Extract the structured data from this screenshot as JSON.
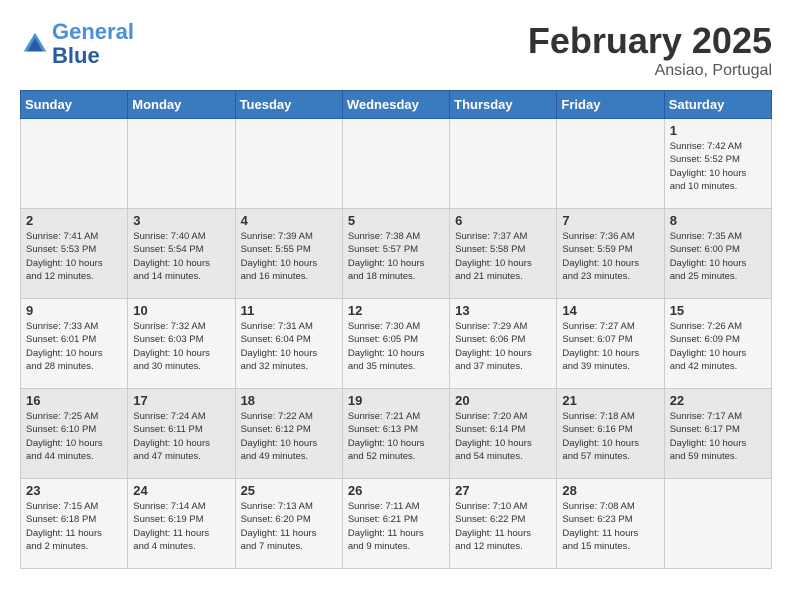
{
  "header": {
    "logo_line1": "General",
    "logo_line2": "Blue",
    "month": "February 2025",
    "location": "Ansiao, Portugal"
  },
  "weekdays": [
    "Sunday",
    "Monday",
    "Tuesday",
    "Wednesday",
    "Thursday",
    "Friday",
    "Saturday"
  ],
  "weeks": [
    [
      {
        "day": "",
        "info": ""
      },
      {
        "day": "",
        "info": ""
      },
      {
        "day": "",
        "info": ""
      },
      {
        "day": "",
        "info": ""
      },
      {
        "day": "",
        "info": ""
      },
      {
        "day": "",
        "info": ""
      },
      {
        "day": "1",
        "info": "Sunrise: 7:42 AM\nSunset: 5:52 PM\nDaylight: 10 hours\nand 10 minutes."
      }
    ],
    [
      {
        "day": "2",
        "info": "Sunrise: 7:41 AM\nSunset: 5:53 PM\nDaylight: 10 hours\nand 12 minutes."
      },
      {
        "day": "3",
        "info": "Sunrise: 7:40 AM\nSunset: 5:54 PM\nDaylight: 10 hours\nand 14 minutes."
      },
      {
        "day": "4",
        "info": "Sunrise: 7:39 AM\nSunset: 5:55 PM\nDaylight: 10 hours\nand 16 minutes."
      },
      {
        "day": "5",
        "info": "Sunrise: 7:38 AM\nSunset: 5:57 PM\nDaylight: 10 hours\nand 18 minutes."
      },
      {
        "day": "6",
        "info": "Sunrise: 7:37 AM\nSunset: 5:58 PM\nDaylight: 10 hours\nand 21 minutes."
      },
      {
        "day": "7",
        "info": "Sunrise: 7:36 AM\nSunset: 5:59 PM\nDaylight: 10 hours\nand 23 minutes."
      },
      {
        "day": "8",
        "info": "Sunrise: 7:35 AM\nSunset: 6:00 PM\nDaylight: 10 hours\nand 25 minutes."
      }
    ],
    [
      {
        "day": "9",
        "info": "Sunrise: 7:33 AM\nSunset: 6:01 PM\nDaylight: 10 hours\nand 28 minutes."
      },
      {
        "day": "10",
        "info": "Sunrise: 7:32 AM\nSunset: 6:03 PM\nDaylight: 10 hours\nand 30 minutes."
      },
      {
        "day": "11",
        "info": "Sunrise: 7:31 AM\nSunset: 6:04 PM\nDaylight: 10 hours\nand 32 minutes."
      },
      {
        "day": "12",
        "info": "Sunrise: 7:30 AM\nSunset: 6:05 PM\nDaylight: 10 hours\nand 35 minutes."
      },
      {
        "day": "13",
        "info": "Sunrise: 7:29 AM\nSunset: 6:06 PM\nDaylight: 10 hours\nand 37 minutes."
      },
      {
        "day": "14",
        "info": "Sunrise: 7:27 AM\nSunset: 6:07 PM\nDaylight: 10 hours\nand 39 minutes."
      },
      {
        "day": "15",
        "info": "Sunrise: 7:26 AM\nSunset: 6:09 PM\nDaylight: 10 hours\nand 42 minutes."
      }
    ],
    [
      {
        "day": "16",
        "info": "Sunrise: 7:25 AM\nSunset: 6:10 PM\nDaylight: 10 hours\nand 44 minutes."
      },
      {
        "day": "17",
        "info": "Sunrise: 7:24 AM\nSunset: 6:11 PM\nDaylight: 10 hours\nand 47 minutes."
      },
      {
        "day": "18",
        "info": "Sunrise: 7:22 AM\nSunset: 6:12 PM\nDaylight: 10 hours\nand 49 minutes."
      },
      {
        "day": "19",
        "info": "Sunrise: 7:21 AM\nSunset: 6:13 PM\nDaylight: 10 hours\nand 52 minutes."
      },
      {
        "day": "20",
        "info": "Sunrise: 7:20 AM\nSunset: 6:14 PM\nDaylight: 10 hours\nand 54 minutes."
      },
      {
        "day": "21",
        "info": "Sunrise: 7:18 AM\nSunset: 6:16 PM\nDaylight: 10 hours\nand 57 minutes."
      },
      {
        "day": "22",
        "info": "Sunrise: 7:17 AM\nSunset: 6:17 PM\nDaylight: 10 hours\nand 59 minutes."
      }
    ],
    [
      {
        "day": "23",
        "info": "Sunrise: 7:15 AM\nSunset: 6:18 PM\nDaylight: 11 hours\nand 2 minutes."
      },
      {
        "day": "24",
        "info": "Sunrise: 7:14 AM\nSunset: 6:19 PM\nDaylight: 11 hours\nand 4 minutes."
      },
      {
        "day": "25",
        "info": "Sunrise: 7:13 AM\nSunset: 6:20 PM\nDaylight: 11 hours\nand 7 minutes."
      },
      {
        "day": "26",
        "info": "Sunrise: 7:11 AM\nSunset: 6:21 PM\nDaylight: 11 hours\nand 9 minutes."
      },
      {
        "day": "27",
        "info": "Sunrise: 7:10 AM\nSunset: 6:22 PM\nDaylight: 11 hours\nand 12 minutes."
      },
      {
        "day": "28",
        "info": "Sunrise: 7:08 AM\nSunset: 6:23 PM\nDaylight: 11 hours\nand 15 minutes."
      },
      {
        "day": "",
        "info": ""
      }
    ]
  ]
}
